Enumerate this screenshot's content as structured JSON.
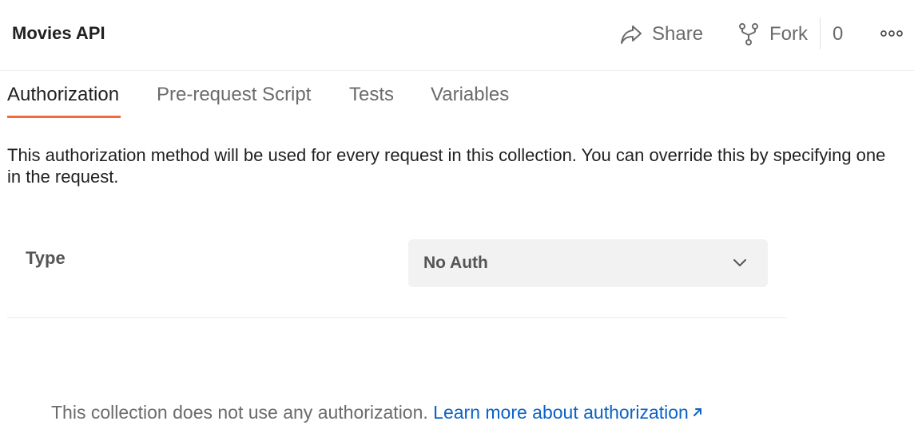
{
  "header": {
    "title": "Movies API",
    "share_label": "Share",
    "fork_label": "Fork",
    "fork_count": "0",
    "share_icon": "share-arrow-icon",
    "fork_icon": "fork-icon",
    "more_icon": "more-options-icon"
  },
  "tabs": [
    {
      "label": "Authorization",
      "active": true
    },
    {
      "label": "Pre-request Script",
      "active": false
    },
    {
      "label": "Tests",
      "active": false
    },
    {
      "label": "Variables",
      "active": false
    }
  ],
  "auth": {
    "description": "This authorization method will be used for every request in this collection. You can override this by specifying one in the request.",
    "type_label": "Type",
    "type_value": "No Auth",
    "note": "This collection does not use any authorization.",
    "learn_more": "Learn more about authorization"
  },
  "colors": {
    "accent": "#ef6c3d",
    "link": "#0b63c6",
    "muted_text": "#6b6b6b",
    "select_bg": "#f2f2f2"
  }
}
